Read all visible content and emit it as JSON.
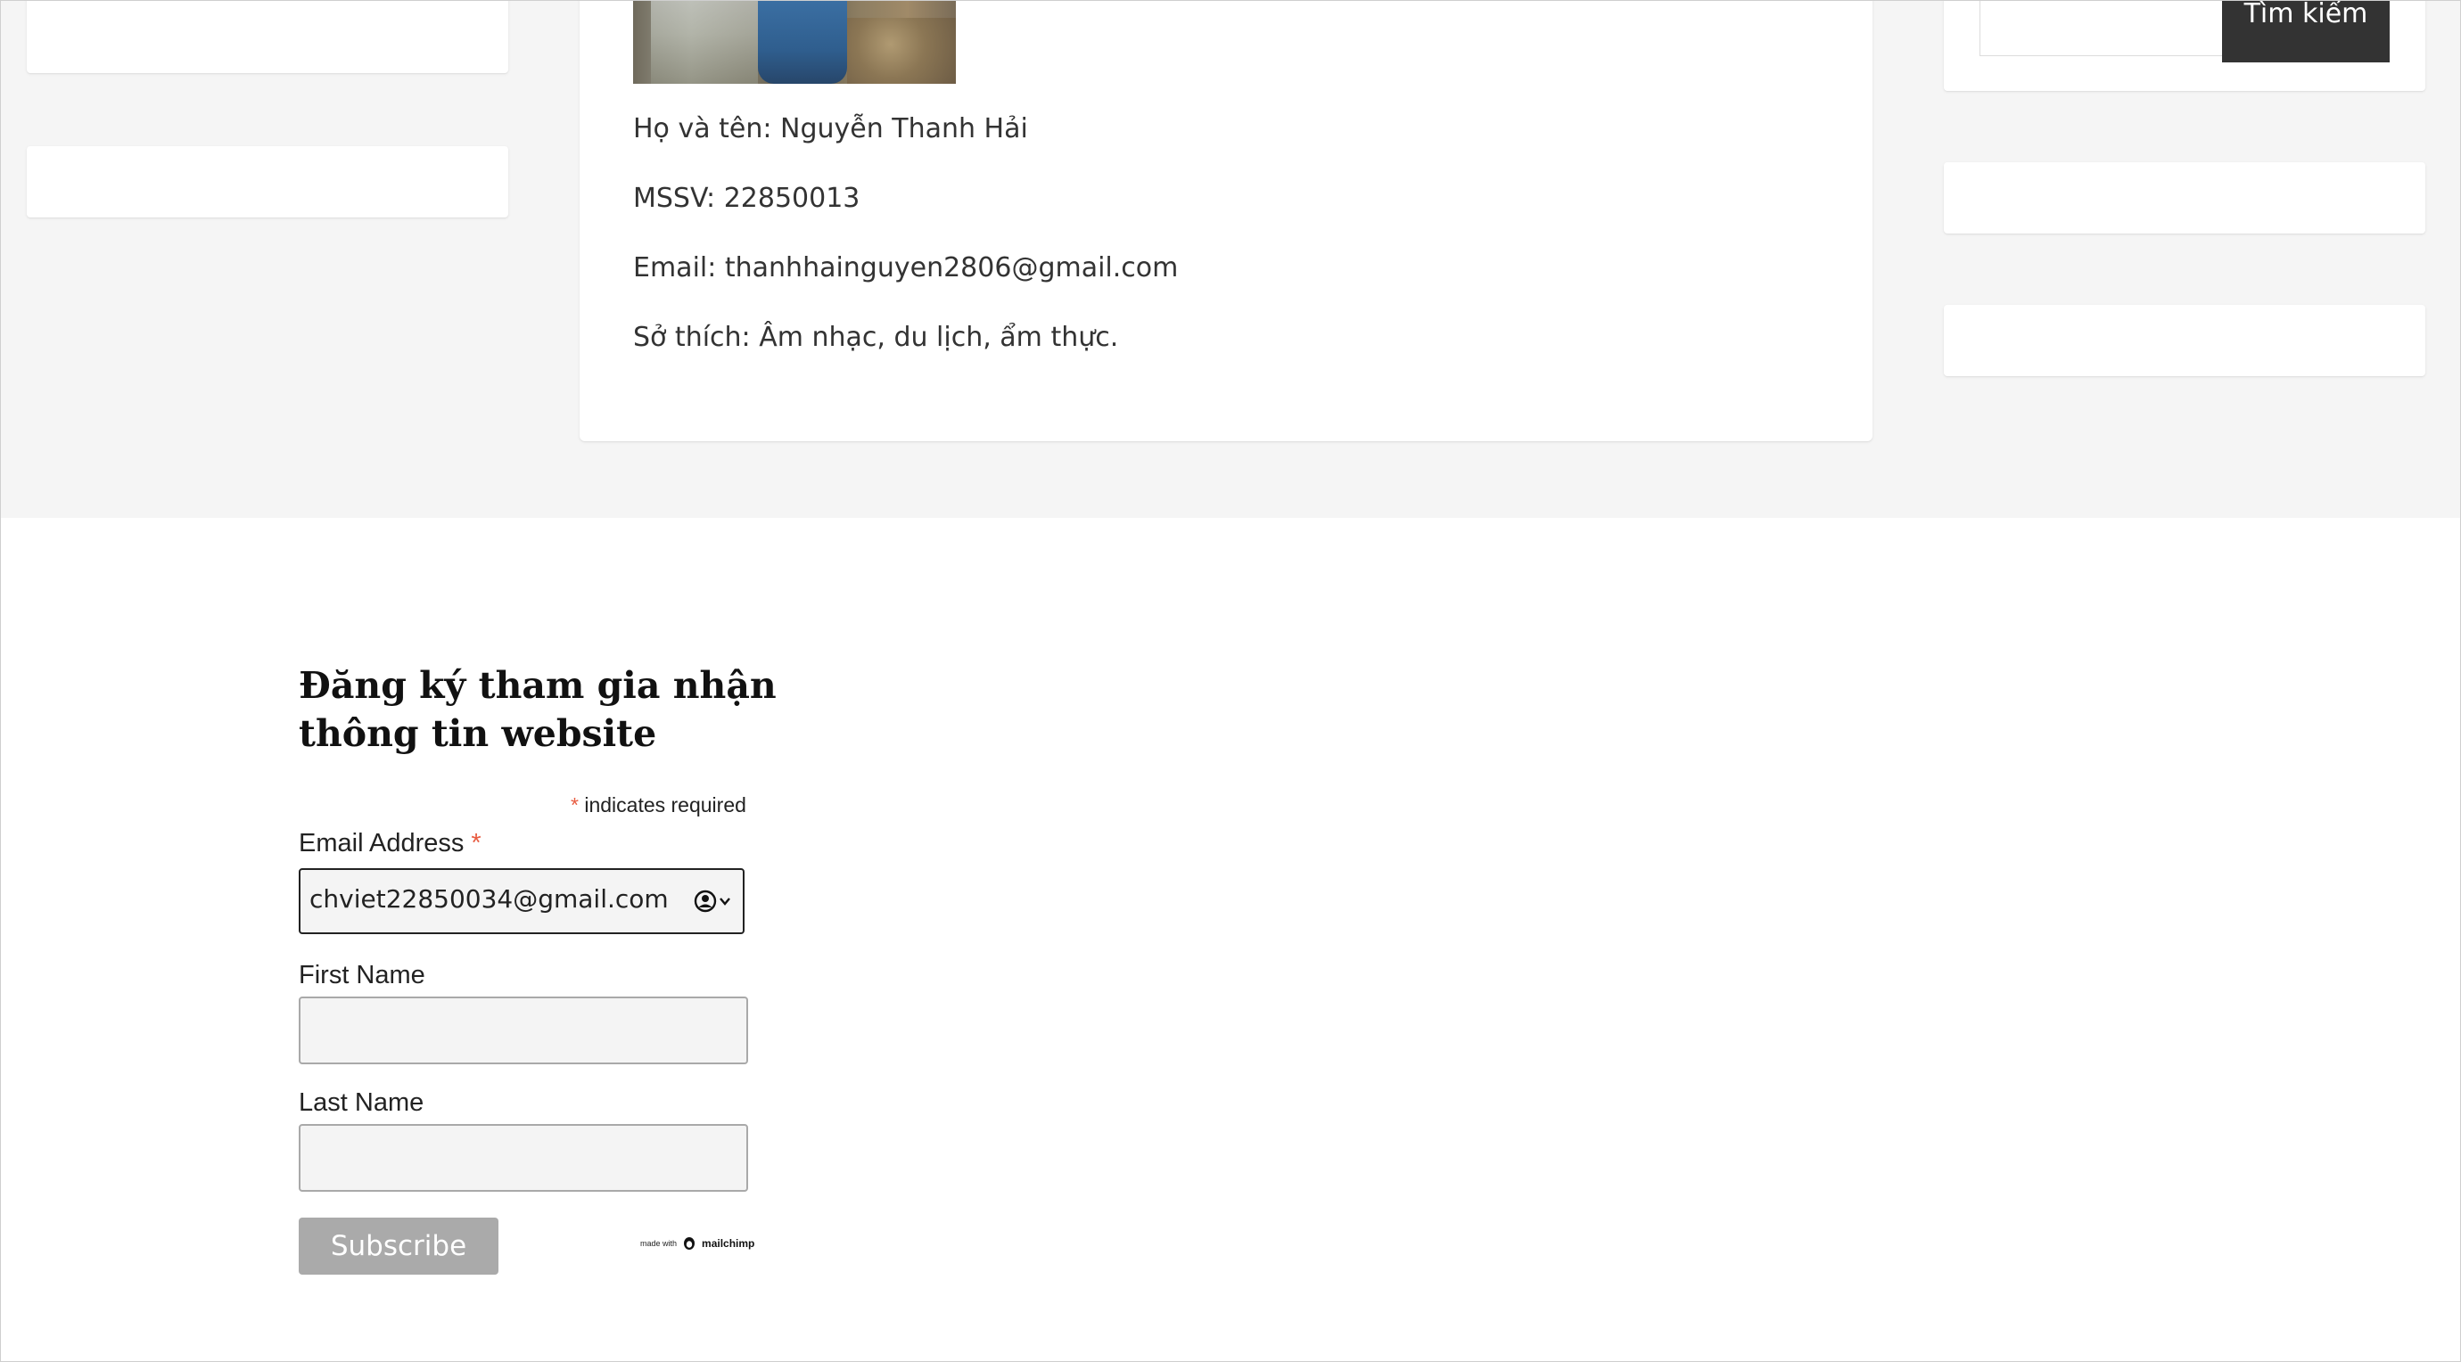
{
  "profile": {
    "name_line": "Họ và tên: Nguyễn Thanh Hải",
    "student_id_line": "MSSV: 22850013",
    "email_line": "Email: thanhhainguyen2806@gmail.com",
    "hobbies_line": "Sở thích: Âm nhạc, du lịch, ẩm thực."
  },
  "search": {
    "button_label": "Tìm kiếm",
    "value": ""
  },
  "signup": {
    "title_line1": "Đăng ký tham gia nhận",
    "title_line2": "thông tin website",
    "required_star": "*",
    "required_note": "indicates required",
    "email_label": "Email Address",
    "email_value": "chviet22850034@gmail.com",
    "first_name_label": "First Name",
    "first_name_value": "",
    "last_name_label": "Last Name",
    "last_name_value": "",
    "subscribe_label": "Subscribe",
    "badge_made_with": "made with",
    "badge_brand": "mailchimp"
  },
  "colors": {
    "page_band": "#f5f5f5",
    "search_button": "#333333",
    "subscribe_button": "#aaaaaa",
    "required_star": "#e85c41"
  },
  "icons": {
    "autofill": "contact-card-autofill-icon"
  }
}
